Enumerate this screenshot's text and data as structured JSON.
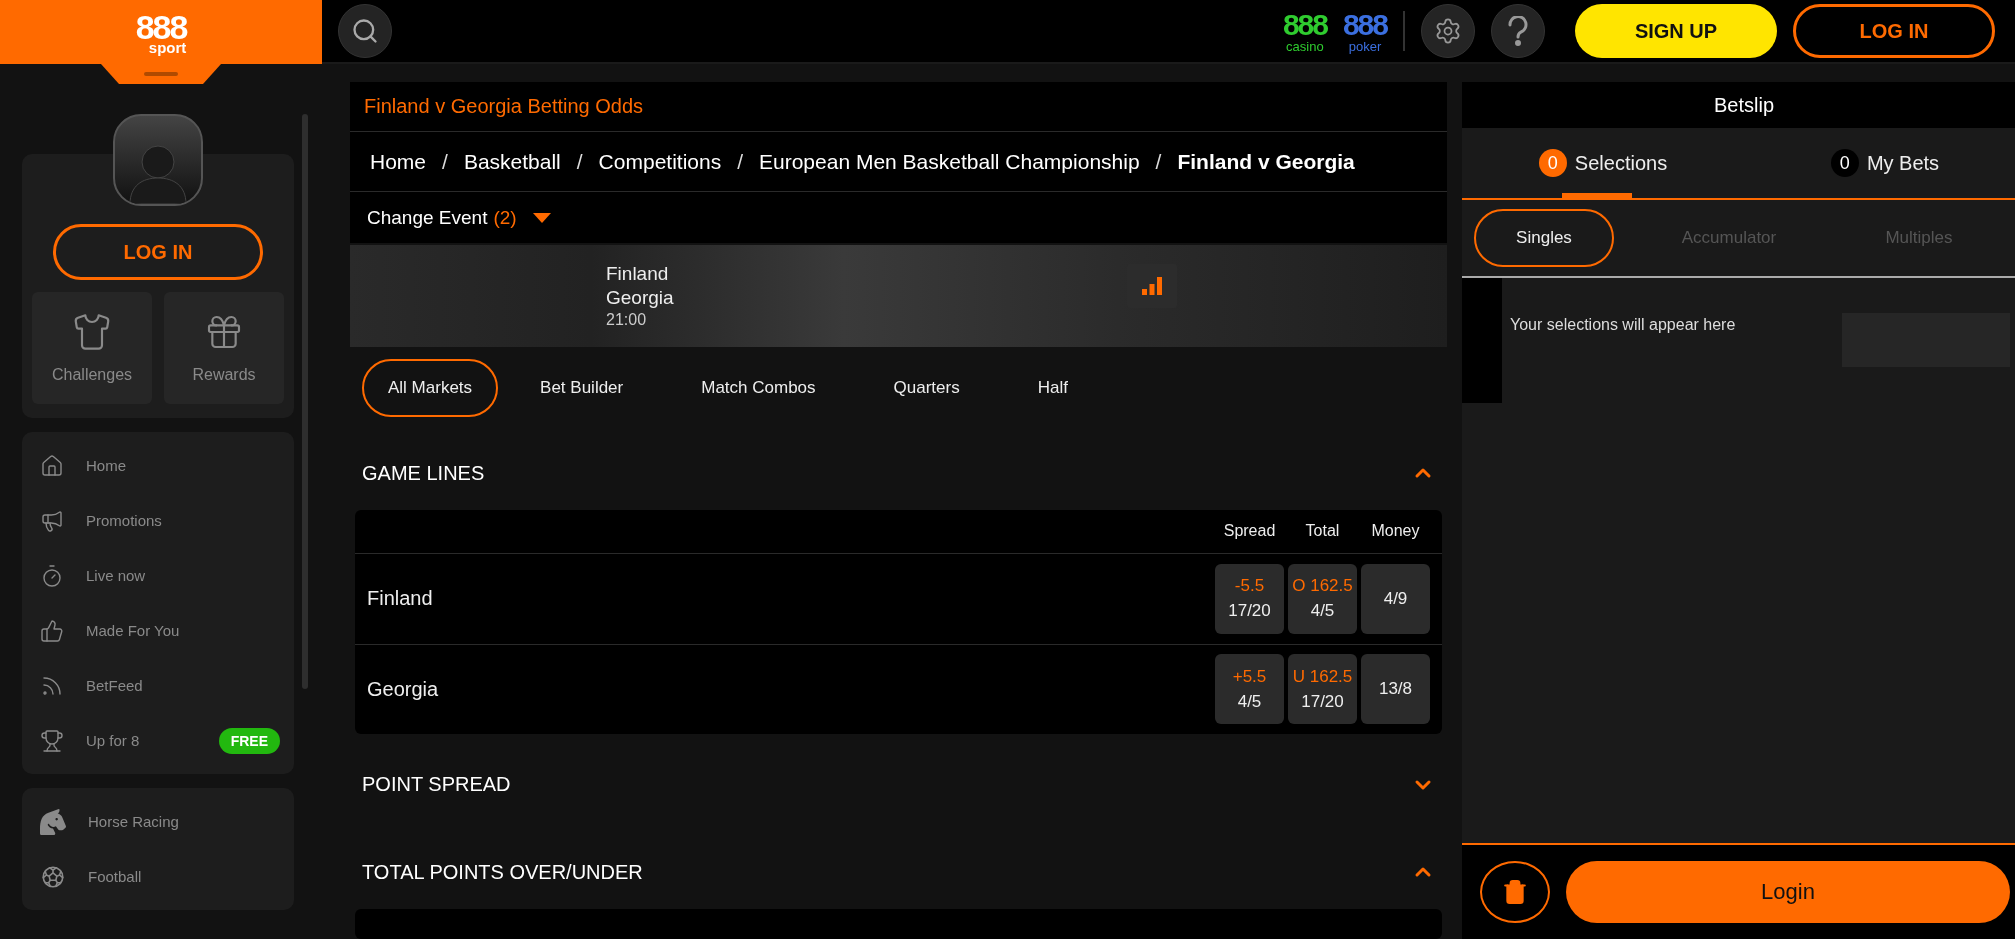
{
  "sidebar": {
    "logo": {
      "number": "888",
      "word": "sport"
    },
    "login_button": "LOG IN",
    "tiles": [
      {
        "label": "Challenges"
      },
      {
        "label": "Rewards"
      }
    ],
    "nav_items": [
      {
        "label": "Home"
      },
      {
        "label": "Promotions"
      },
      {
        "label": "Live now"
      },
      {
        "label": "Made For You"
      },
      {
        "label": "BetFeed"
      },
      {
        "label": "Up for 8",
        "badge": "FREE"
      }
    ],
    "sports": [
      {
        "label": "Horse Racing"
      },
      {
        "label": "Football"
      }
    ]
  },
  "top_bar": {
    "brands": [
      {
        "number": "888",
        "word": "casino",
        "color": "#2fcc2f"
      },
      {
        "number": "888",
        "word": "poker",
        "color": "#3b6fe0"
      }
    ],
    "sign_up": "SIGN UP",
    "log_in": "LOG IN"
  },
  "event_page": {
    "title": "Finland v Georgia Betting Odds",
    "breadcrumb": {
      "separator": "/",
      "items": [
        {
          "label": "Home",
          "current": false
        },
        {
          "label": "Basketball",
          "current": false
        },
        {
          "label": "Competitions",
          "current": false
        },
        {
          "label": "European Men Basketball Championship",
          "current": false
        },
        {
          "label": "Finland v Georgia",
          "current": true
        }
      ]
    },
    "change_event": {
      "label": "Change Event",
      "count": "(2)"
    },
    "event": {
      "home": "Finland",
      "away": "Georgia",
      "time": "21:00"
    },
    "market_tabs": [
      {
        "label": "All Markets",
        "selected": true
      },
      {
        "label": "Bet Builder",
        "selected": false
      },
      {
        "label": "Match Combos",
        "selected": false
      },
      {
        "label": "Quarters",
        "selected": false
      },
      {
        "label": "Half",
        "selected": false
      }
    ],
    "markets": [
      {
        "title": "GAME LINES",
        "expanded": true,
        "columns": [
          "Spread",
          "Total",
          "Money"
        ],
        "rows": [
          {
            "team": "Finland",
            "odds": [
              {
                "line": "-5.5",
                "price": "17/20"
              },
              {
                "line": "O 162.5",
                "price": "4/5"
              },
              {
                "price": "4/9"
              }
            ]
          },
          {
            "team": "Georgia",
            "odds": [
              {
                "line": "+5.5",
                "price": "4/5"
              },
              {
                "line": "U 162.5",
                "price": "17/20"
              },
              {
                "price": "13/8"
              }
            ]
          }
        ]
      },
      {
        "title": "POINT SPREAD",
        "expanded": false
      },
      {
        "title": "TOTAL POINTS OVER/UNDER",
        "expanded": true
      }
    ]
  },
  "betslip": {
    "title": "Betslip",
    "tabs": [
      {
        "count": "0",
        "label": "Selections",
        "selected": true
      },
      {
        "count": "0",
        "label": "My Bets",
        "selected": false
      }
    ],
    "bet_types": [
      {
        "label": "Singles",
        "selected": true
      },
      {
        "label": "Accumulator",
        "selected": false
      },
      {
        "label": "Multiples",
        "selected": false
      }
    ],
    "empty_message": "Your selections will appear here",
    "login_button": "Login"
  }
}
